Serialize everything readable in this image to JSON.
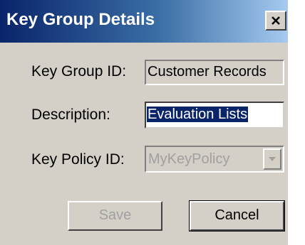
{
  "window": {
    "title": "Key Group Details"
  },
  "fields": {
    "key_group_id": {
      "label": "Key Group ID:",
      "value": "Customer Records"
    },
    "description": {
      "label": "Description:",
      "value": "Evaluation Lists"
    },
    "key_policy_id": {
      "label": "Key Policy ID:",
      "selected": "MyKeyPolicy"
    }
  },
  "buttons": {
    "save_label": "Save",
    "cancel_label": "Cancel"
  },
  "icons": {
    "close": "close-icon",
    "dropdown": "chevron-down-icon"
  },
  "colors": {
    "title_bar_start": "#0a246a",
    "title_bar_end": "#a6caf0",
    "dialog_face": "#d4d0c8",
    "selection": "#0a246a",
    "disabled_text": "#a0a0a0"
  }
}
